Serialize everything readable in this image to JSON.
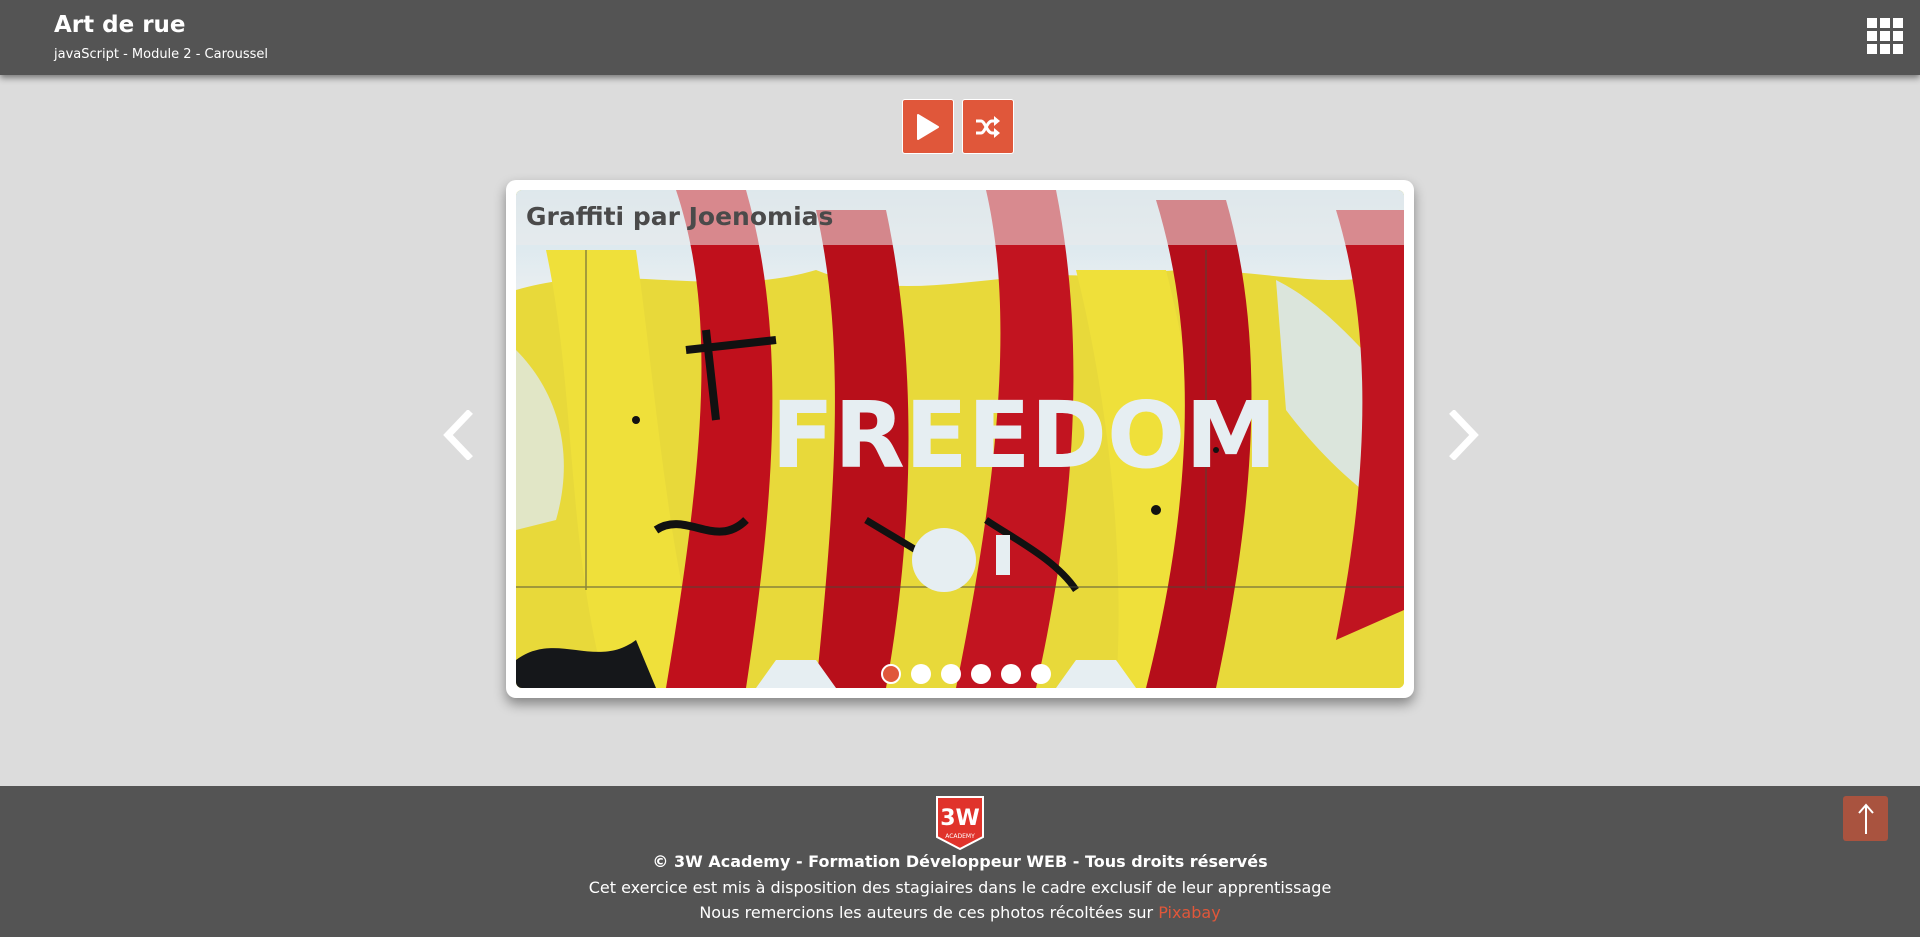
{
  "header": {
    "title": "Art de rue",
    "subtitle": "javaScript - Module 2 - Caroussel",
    "menu_icon": "grid-icon"
  },
  "toolbar": {
    "play_icon": "play-icon",
    "shuffle_icon": "shuffle-icon",
    "accent": "#e0573a"
  },
  "carousel": {
    "caption": "Graffiti par Joenomias",
    "slide_text": "FREEDOM",
    "slide_count": 6,
    "active_index": 0,
    "prev_icon": "chevron-left-icon",
    "next_icon": "chevron-right-icon"
  },
  "footer": {
    "logo_text": "3W",
    "logo_sub": "ACADEMY",
    "copyright": "© 3W Academy - Formation Développeur WEB - Tous droits réservés",
    "notice": "Cet exercice est mis à disposition des stagiaires dans le cadre exclusif de leur apprentissage",
    "thanks_prefix": "Nous remercions les auteurs de ces photos récoltées sur ",
    "thanks_link": "Pixabay",
    "back_to_top_icon": "arrow-up-icon"
  }
}
